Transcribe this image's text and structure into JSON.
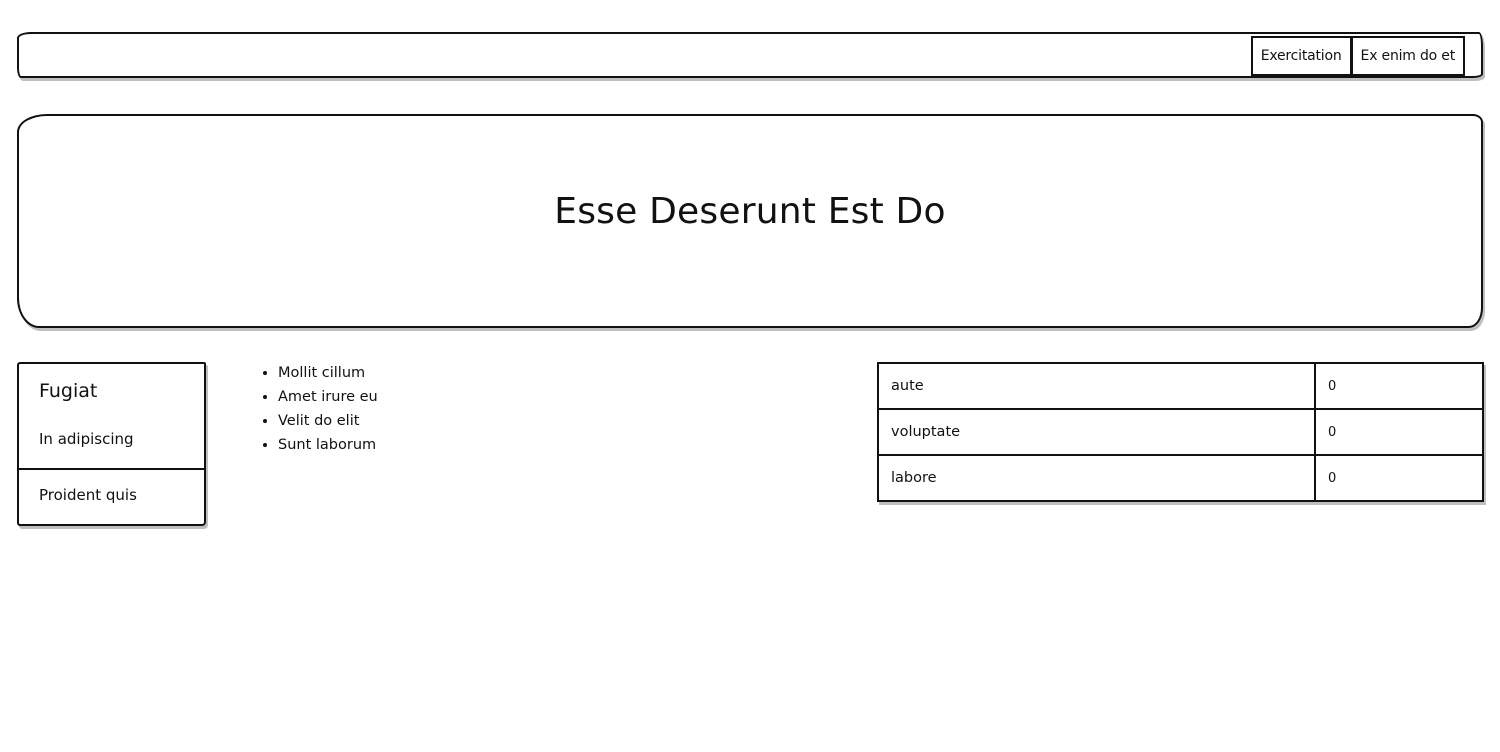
{
  "nav": {
    "buttons": [
      "Exercitation",
      "Ex enim do et"
    ]
  },
  "hero": {
    "title": "Esse Deserunt Est Do"
  },
  "card": {
    "title": "Fugiat",
    "subtitle": "In adipiscing",
    "footer": "Proident quis"
  },
  "list": {
    "items": [
      "Mollit cillum",
      "Amet irure eu",
      "Velit do elit",
      "Sunt laborum"
    ]
  },
  "table": {
    "rows": [
      {
        "label": "aute",
        "value": "0"
      },
      {
        "label": "voluptate",
        "value": "0"
      },
      {
        "label": "labore",
        "value": "0"
      }
    ]
  }
}
